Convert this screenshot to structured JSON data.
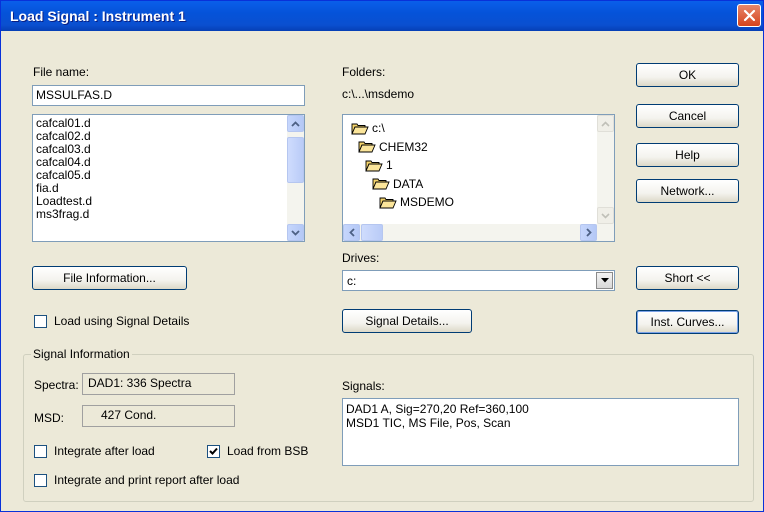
{
  "window": {
    "title": "Load Signal : Instrument 1"
  },
  "file": {
    "label": "File name:",
    "value": "MSSULFAS.D",
    "list": [
      "cafcal01.d",
      "cafcal02.d",
      "cafcal03.d",
      "cafcal04.d",
      "cafcal05.d",
      "fia.d",
      "Loadtest.d",
      "ms3frag.d"
    ]
  },
  "folders": {
    "label": "Folders:",
    "path": "c:\\...\\msdemo",
    "tree": [
      "c:\\",
      "CHEM32",
      "1",
      "DATA",
      "MSDEMO"
    ]
  },
  "drives": {
    "label": "Drives:",
    "value": "c:"
  },
  "buttons": {
    "ok": "OK",
    "cancel": "Cancel",
    "help": "Help",
    "network": "Network...",
    "short": "Short <<",
    "inst_curves": "Inst. Curves...",
    "file_info": "File Information...",
    "signal_details": "Signal Details..."
  },
  "options": {
    "load_signal_details": "Load using Signal Details",
    "integrate_after_load": "Integrate after load",
    "load_from_bsb": "Load from BSB",
    "integrate_print": "Integrate and print report after load"
  },
  "signal_info": {
    "group_label": "Signal Information",
    "spectra_label": "Spectra:",
    "spectra_value": "DAD1: 336 Spectra",
    "msd_label": "MSD:",
    "msd_value": "427 Cond.",
    "signals_label": "Signals:",
    "signals": [
      "DAD1 A, Sig=270,20 Ref=360,100",
      "MSD1 TIC, MS File, Pos, Scan"
    ]
  },
  "colors": {
    "titlebar": "#0553d9",
    "dialog_bg": "#ece9d8",
    "close": "#d5431c",
    "folder": "#f5d46a"
  }
}
